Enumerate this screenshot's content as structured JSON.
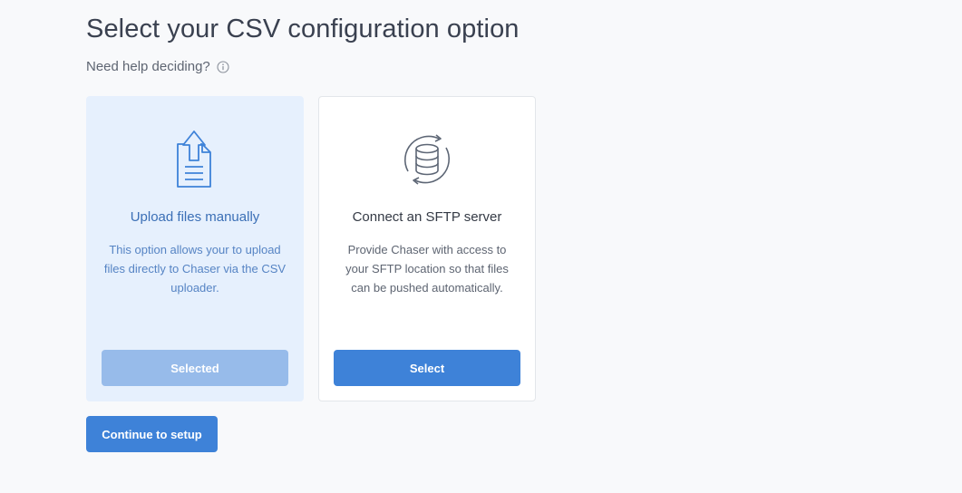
{
  "header": {
    "title": "Select your CSV configuration option",
    "help_text": "Need help deciding?",
    "help_icon": "info-icon"
  },
  "options": [
    {
      "title": "Upload files manually",
      "description": "This option allows your to upload files directly to Chaser via the CSV uploader.",
      "button_label": "Selected",
      "icon": "file-upload-icon",
      "state": "selected"
    },
    {
      "title": "Connect an SFTP server",
      "description": "Provide Chaser with access to your SFTP location so that files can be pushed automatically.",
      "button_label": "Select",
      "icon": "database-sync-icon",
      "state": "unselected"
    }
  ],
  "footer": {
    "continue_label": "Continue to setup"
  },
  "colors": {
    "accent": "#3e82d8",
    "selected_card_bg": "#e6f0fd",
    "selected_button": "#97bbea",
    "selected_title": "#3b6fb6",
    "page_bg": "#f8f9fb"
  }
}
